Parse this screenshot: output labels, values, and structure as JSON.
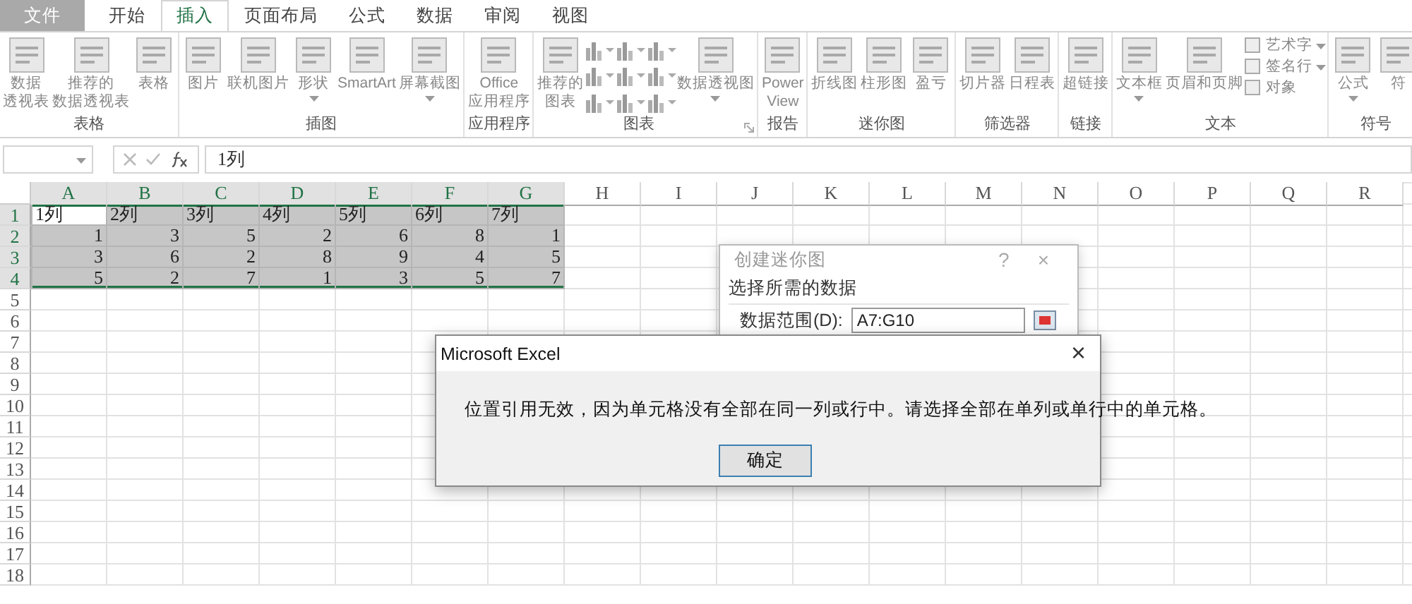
{
  "tabs": [
    {
      "label": "文件",
      "kind": "file",
      "selected": false
    },
    {
      "label": "开始",
      "kind": "tab",
      "selected": false
    },
    {
      "label": "插入",
      "kind": "tab",
      "selected": true
    },
    {
      "label": "页面布局",
      "kind": "tab",
      "selected": false
    },
    {
      "label": "公式",
      "kind": "tab",
      "selected": false
    },
    {
      "label": "数据",
      "kind": "tab",
      "selected": false
    },
    {
      "label": "审阅",
      "kind": "tab",
      "selected": false
    },
    {
      "label": "视图",
      "kind": "tab",
      "selected": false
    }
  ],
  "ribbon": {
    "groups": [
      {
        "label": "表格",
        "items": [
          {
            "kind": "large",
            "lines": [
              "数据",
              "透视表"
            ],
            "has_menu": false
          },
          {
            "kind": "large",
            "lines": [
              "推荐的",
              "数据透视表"
            ],
            "has_menu": false
          },
          {
            "kind": "large",
            "label": "表格",
            "has_menu": false
          }
        ]
      },
      {
        "label": "插图",
        "items": [
          {
            "kind": "large",
            "label": "图片",
            "has_menu": false
          },
          {
            "kind": "large",
            "label": "联机图片",
            "has_menu": false
          },
          {
            "kind": "large",
            "label": "形状",
            "has_menu": true
          },
          {
            "kind": "large",
            "label": "SmartArt",
            "has_menu": false
          },
          {
            "kind": "large",
            "label": "屏幕截图",
            "has_menu": true
          }
        ]
      },
      {
        "label": "应用程序",
        "items": [
          {
            "kind": "large",
            "label": "Office\n应用程序",
            "has_menu": false
          }
        ]
      },
      {
        "label": "图表",
        "launcher": true,
        "items": [
          {
            "kind": "large",
            "lines": [
              "推荐的",
              "图表"
            ],
            "has_menu": false
          },
          {
            "kind": "chart_icons"
          },
          {
            "kind": "large",
            "label": "数据透视图",
            "has_menu": true
          }
        ]
      },
      {
        "label": "报告",
        "items": [
          {
            "kind": "large",
            "label": "Power\nView",
            "has_menu": false
          }
        ]
      },
      {
        "label": "迷你图",
        "items": [
          {
            "kind": "large",
            "label": "折线图",
            "has_menu": false
          },
          {
            "kind": "large",
            "label": "柱形图",
            "has_menu": false
          },
          {
            "kind": "large",
            "label": "盈亏",
            "has_menu": false
          }
        ]
      },
      {
        "label": "筛选器",
        "items": [
          {
            "kind": "large",
            "label": "切片器",
            "has_menu": false
          },
          {
            "kind": "large",
            "label": "日程表",
            "has_menu": false
          }
        ]
      },
      {
        "label": "链接",
        "items": [
          {
            "kind": "large",
            "label": "超链接",
            "has_menu": false
          }
        ]
      },
      {
        "label": "文本",
        "items": [
          {
            "kind": "large",
            "label": "文本框",
            "has_menu": true
          },
          {
            "kind": "large",
            "label": "页眉和页脚",
            "has_menu": false
          },
          {
            "kind": "stack",
            "items": [
              {
                "label": "艺术字",
                "has_menu": true
              },
              {
                "label": "签名行",
                "has_menu": true
              },
              {
                "label": "对象",
                "has_menu": false
              }
            ]
          }
        ]
      },
      {
        "label": "符号",
        "items": [
          {
            "kind": "large",
            "label": "公式",
            "has_menu": true
          },
          {
            "kind": "large",
            "label": "符",
            "has_menu": false
          }
        ]
      }
    ]
  },
  "formula_bar": {
    "formula": "1列"
  },
  "grid": {
    "columns": [
      {
        "label": "A",
        "selected": true
      },
      {
        "label": "B",
        "selected": true
      },
      {
        "label": "C",
        "selected": true
      },
      {
        "label": "D",
        "selected": true
      },
      {
        "label": "E",
        "selected": true
      },
      {
        "label": "F",
        "selected": true
      },
      {
        "label": "G",
        "selected": true
      },
      {
        "label": "H",
        "selected": false
      },
      {
        "label": "I",
        "selected": false
      },
      {
        "label": "J",
        "selected": false
      },
      {
        "label": "K",
        "selected": false
      },
      {
        "label": "L",
        "selected": false
      },
      {
        "label": "M",
        "selected": false
      },
      {
        "label": "N",
        "selected": false
      },
      {
        "label": "O",
        "selected": false
      },
      {
        "label": "P",
        "selected": false
      },
      {
        "label": "Q",
        "selected": false
      },
      {
        "label": "R",
        "selected": false
      }
    ],
    "rows": [
      {
        "label": "1",
        "selected": true,
        "cells": [
          {
            "text": "1列",
            "kind": "text",
            "active": true
          },
          {
            "text": "2列",
            "kind": "text",
            "active": false
          },
          {
            "text": "3列",
            "kind": "text",
            "active": false
          },
          {
            "text": "4列",
            "kind": "text",
            "active": false
          },
          {
            "text": "5列",
            "kind": "text",
            "active": false
          },
          {
            "text": "6列",
            "kind": "text",
            "active": false
          },
          {
            "text": "7列",
            "kind": "text",
            "active": false
          }
        ]
      },
      {
        "label": "2",
        "selected": true,
        "cells": [
          {
            "text": "1",
            "kind": "number",
            "active": false
          },
          {
            "text": "3",
            "kind": "number",
            "active": false
          },
          {
            "text": "5",
            "kind": "number",
            "active": false
          },
          {
            "text": "2",
            "kind": "number",
            "active": false
          },
          {
            "text": "6",
            "kind": "number",
            "active": false
          },
          {
            "text": "8",
            "kind": "number",
            "active": false
          },
          {
            "text": "1",
            "kind": "number",
            "active": false
          }
        ]
      },
      {
        "label": "3",
        "selected": true,
        "cells": [
          {
            "text": "3",
            "kind": "number",
            "active": false
          },
          {
            "text": "6",
            "kind": "number",
            "active": false
          },
          {
            "text": "2",
            "kind": "number",
            "active": false
          },
          {
            "text": "8",
            "kind": "number",
            "active": false
          },
          {
            "text": "9",
            "kind": "number",
            "active": false
          },
          {
            "text": "4",
            "kind": "number",
            "active": false
          },
          {
            "text": "5",
            "kind": "number",
            "active": false
          }
        ]
      },
      {
        "label": "4",
        "selected": true,
        "cells": [
          {
            "text": "5",
            "kind": "number",
            "active": false
          },
          {
            "text": "2",
            "kind": "number",
            "active": false
          },
          {
            "text": "7",
            "kind": "number",
            "active": false
          },
          {
            "text": "1",
            "kind": "number",
            "active": false
          },
          {
            "text": "3",
            "kind": "number",
            "active": false
          },
          {
            "text": "5",
            "kind": "number",
            "active": false
          },
          {
            "text": "7",
            "kind": "number",
            "active": false
          }
        ]
      },
      {
        "label": "5",
        "selected": false
      },
      {
        "label": "6",
        "selected": false
      },
      {
        "label": "7",
        "selected": false
      },
      {
        "label": "8",
        "selected": false
      },
      {
        "label": "9",
        "selected": false
      },
      {
        "label": "10",
        "selected": false
      },
      {
        "label": "11",
        "selected": false
      },
      {
        "label": "12",
        "selected": false
      },
      {
        "label": "13",
        "selected": false
      },
      {
        "label": "14",
        "selected": false
      },
      {
        "label": "15",
        "selected": false
      },
      {
        "label": "16",
        "selected": false
      },
      {
        "label": "17",
        "selected": false
      },
      {
        "label": "18",
        "selected": false
      }
    ]
  },
  "sparkline_dialog": {
    "title": "创建迷你图",
    "help": "?",
    "close": "×",
    "section": "选择所需的数据",
    "field_label": "数据范围(D):",
    "field_value": "A7:G10"
  },
  "message_box": {
    "title": "Microsoft Excel",
    "close": "×",
    "message": "位置引用无效，因为单元格没有全部在同一列或行中。请选择全部在单列或单行中的单元格。",
    "button": "确定"
  }
}
